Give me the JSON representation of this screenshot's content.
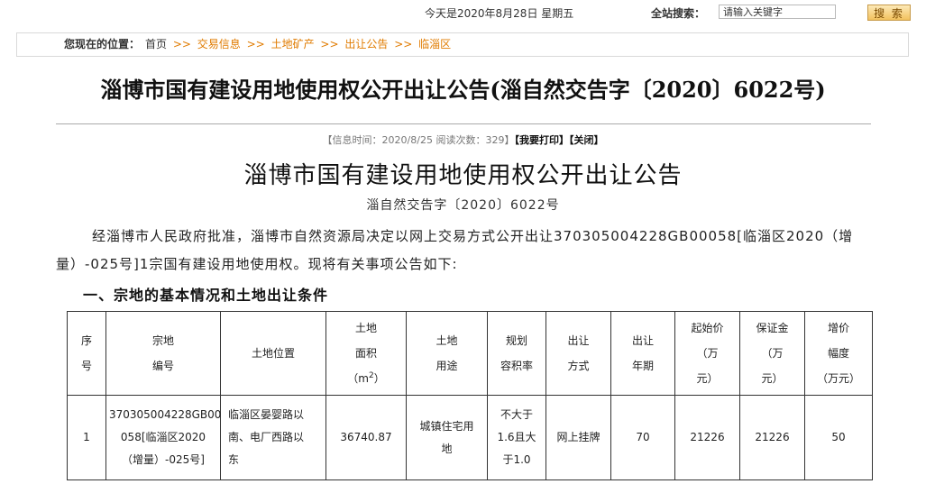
{
  "topbar": {
    "date_text": "今天是2020年8月28日 星期五",
    "search_label": "全站搜索：",
    "search_placeholder": "请输入关键字",
    "search_button": "搜 索"
  },
  "breadcrumb": {
    "lead": "您现在的位置：",
    "home": "首页",
    "separator": ">>",
    "items": [
      "交易信息",
      "土地矿产",
      "出让公告",
      "临淄区"
    ]
  },
  "article": {
    "title": "淄博市国有建设用地使用权公开出让公告(淄自然交告字〔2020〕6022号)",
    "meta_info": "【信息时间：2020/8/25 阅读次数：329】",
    "print_label": "【我要打印】",
    "close_label": "【关闭】",
    "doc_title": "淄博市国有建设用地使用权公开出让公告",
    "doc_number": "淄自然交告字〔2020〕6022号",
    "intro": "经淄博市人民政府批准，淄博市自然资源局决定以网上交易方式公开出让370305004228GB00058[临淄区2020（增量）-025号]1宗国有建设用地使用权。现将有关事项公告如下:",
    "section_heading": "一、宗地的基本情况和土地出让条件"
  },
  "table": {
    "headers": {
      "seq_a": "序",
      "seq_b": "号",
      "parcel_a": "宗地",
      "parcel_b": "编号",
      "location": "土地位置",
      "area_a": "土地",
      "area_b": "面积",
      "area_c": "（m",
      "area_sup": "2",
      "area_d": "）",
      "use_a": "土地",
      "use_b": "用途",
      "far_a": "规划",
      "far_b": "容积率",
      "method_a": "出让",
      "method_b": "方式",
      "term_a": "出让",
      "term_b": "年期",
      "start_a": "起始价",
      "start_b": "（万",
      "start_c": "元）",
      "deposit_a": "保证金",
      "deposit_b": "（万",
      "deposit_c": "元）",
      "inc_a": "增价",
      "inc_b": "幅度",
      "inc_c": "（万元）"
    },
    "row": {
      "seq": "1",
      "parcel_a": "370305004228GB00",
      "parcel_b": "058[临淄区2020",
      "parcel_c": "（增量）-025号]",
      "location_a": "临淄区晏婴路以",
      "location_b": "南、电厂西路以",
      "location_c": "东",
      "area": "36740.87",
      "use_a": "城镇住宅用",
      "use_b": "地",
      "far_a": "不大于",
      "far_b": "1.6且大",
      "far_c": "于1.0",
      "method": "网上挂牌",
      "term": "70",
      "start_price": "21226",
      "deposit": "21226",
      "increment": "50"
    }
  }
}
